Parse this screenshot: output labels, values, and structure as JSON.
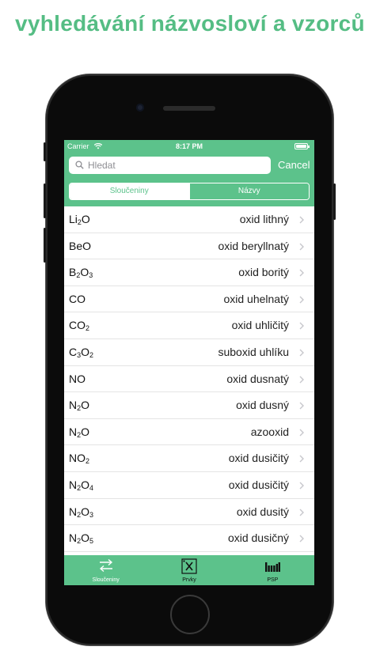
{
  "headline": "vyhledávání názvosloví a vzorců",
  "status_bar": {
    "carrier": "Carrier",
    "time": "8:17 PM"
  },
  "search": {
    "placeholder": "Hledat",
    "value": "",
    "cancel_label": "Cancel"
  },
  "segments": [
    {
      "label": "Sloučeniny",
      "selected": true
    },
    {
      "label": "Názvy",
      "selected": false
    }
  ],
  "compounds": [
    {
      "formula": [
        {
          "t": "Li"
        },
        {
          "s": "2"
        },
        {
          "t": "O"
        }
      ],
      "name": "oxid lithný"
    },
    {
      "formula": [
        {
          "t": "BeO"
        }
      ],
      "name": "oxid beryllnatý"
    },
    {
      "formula": [
        {
          "t": "B"
        },
        {
          "s": "2"
        },
        {
          "t": "O"
        },
        {
          "s": "3"
        }
      ],
      "name": "oxid boritý"
    },
    {
      "formula": [
        {
          "t": "CO"
        }
      ],
      "name": "oxid uhelnatý"
    },
    {
      "formula": [
        {
          "t": "CO"
        },
        {
          "s": "2"
        }
      ],
      "name": "oxid uhličitý"
    },
    {
      "formula": [
        {
          "t": "C"
        },
        {
          "s": "3"
        },
        {
          "t": "O"
        },
        {
          "s": "2"
        }
      ],
      "name": "suboxid uhlíku"
    },
    {
      "formula": [
        {
          "t": "NO"
        }
      ],
      "name": "oxid dusnatý"
    },
    {
      "formula": [
        {
          "t": "N"
        },
        {
          "s": "2"
        },
        {
          "t": "O"
        }
      ],
      "name": "oxid dusný"
    },
    {
      "formula": [
        {
          "t": "N"
        },
        {
          "s": "2"
        },
        {
          "t": "O"
        }
      ],
      "name": "azooxid"
    },
    {
      "formula": [
        {
          "t": "NO"
        },
        {
          "s": "2"
        }
      ],
      "name": "oxid dusičitý"
    },
    {
      "formula": [
        {
          "t": "N"
        },
        {
          "s": "2"
        },
        {
          "t": "O"
        },
        {
          "s": "4"
        }
      ],
      "name": "oxid dusičitý"
    },
    {
      "formula": [
        {
          "t": "N"
        },
        {
          "s": "2"
        },
        {
          "t": "O"
        },
        {
          "s": "3"
        }
      ],
      "name": "oxid dusitý"
    },
    {
      "formula": [
        {
          "t": "N"
        },
        {
          "s": "2"
        },
        {
          "t": "O"
        },
        {
          "s": "5"
        }
      ],
      "name": "oxid dusičný"
    }
  ],
  "tabs": [
    {
      "label": "Sloučeniny",
      "icon": "swap-arrows-icon"
    },
    {
      "label": "Prvky",
      "icon": "element-box-icon"
    },
    {
      "label": "PSP",
      "icon": "periodic-table-icon"
    }
  ],
  "colors": {
    "accent": "#5cc28b",
    "headline": "#55bd84",
    "phone_body": "#0b0b0b"
  }
}
